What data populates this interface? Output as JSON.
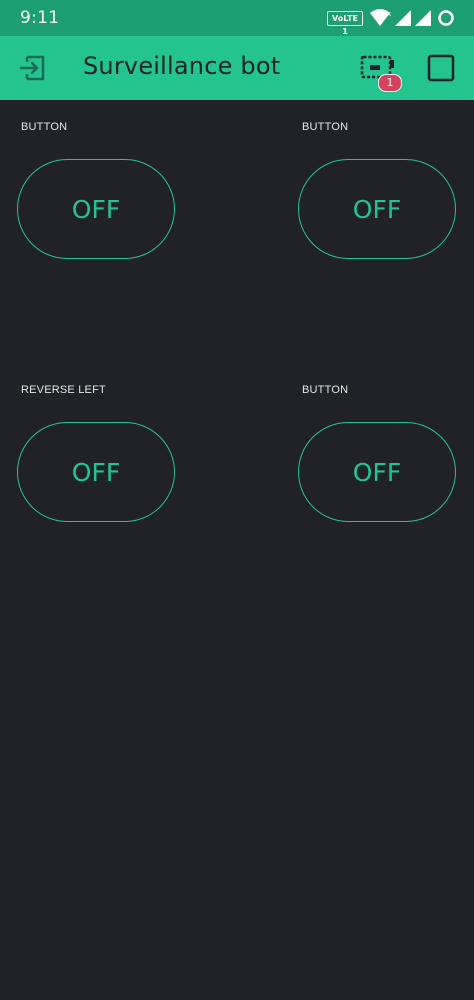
{
  "status_bar": {
    "time": "9:11",
    "volte_label": "VoLTE 1",
    "icons": [
      "wifi-icon",
      "signal-icon",
      "signal-icon-2",
      "loading-circle-icon"
    ]
  },
  "app_bar": {
    "title": "Surveillance bot",
    "left_icon": "exit-icon",
    "device_icon": "device-icon",
    "device_badge": "1",
    "right_icon": "square-icon"
  },
  "widgets": [
    {
      "label": "BUTTON",
      "state": "OFF"
    },
    {
      "label": "BUTTON",
      "state": "OFF"
    },
    {
      "label": "REVERSE LEFT",
      "state": "OFF"
    },
    {
      "label": "BUTTON",
      "state": "OFF"
    }
  ],
  "colors": {
    "status_bar": "#1e9e73",
    "app_bar": "#23c48e",
    "background": "#212227",
    "accent": "#23c48e",
    "badge": "#d3435c"
  }
}
